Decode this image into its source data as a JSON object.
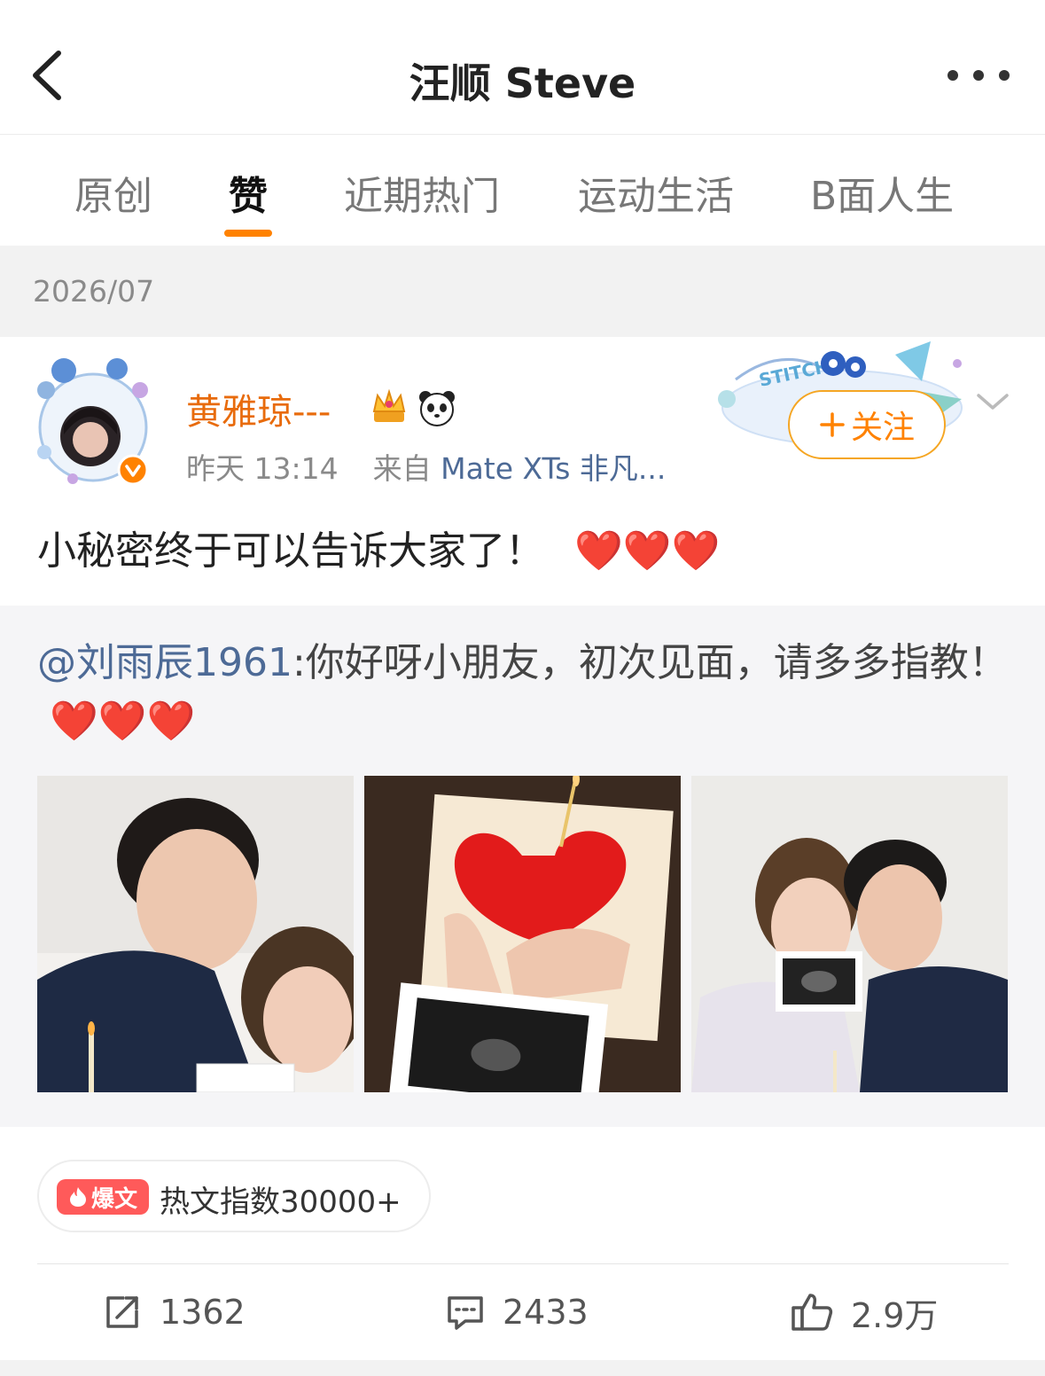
{
  "header": {
    "title": "汪顺 Steve",
    "back_icon": "chevron-left-icon",
    "more_icon": "more-dots-icon"
  },
  "tabs": [
    {
      "label": "原创",
      "active": false
    },
    {
      "label": "赞",
      "active": true
    },
    {
      "label": "近期热门",
      "active": false
    },
    {
      "label": "运动生活",
      "active": false
    },
    {
      "label": "B面人生",
      "active": false
    }
  ],
  "date_section": {
    "label": "2026/07"
  },
  "post": {
    "author": "黄雅琼---",
    "author_badges": [
      "crown-icon",
      "panda-icon"
    ],
    "time": "昨天 13:14",
    "source_prefix": "来自",
    "source": "Mate XTs 非凡...",
    "follow_label": "关注",
    "text": "小秘密终于可以告诉大家了！",
    "text_emoji": "❤️❤️❤️",
    "repost": {
      "mention": "@刘雨辰1961",
      "text": ":你好呀小朋友，初次见面，请多多指教！",
      "text_emoji": "❤️❤️❤️",
      "photos": [
        {
          "name": "photo-couple-selfie"
        },
        {
          "name": "photo-heart-cake-ultrasound"
        },
        {
          "name": "photo-couple-ultrasound"
        }
      ]
    },
    "hot": {
      "tag": "爆文",
      "text": "热文指数30000+"
    },
    "actions": {
      "repost_count": "1362",
      "comment_count": "2433",
      "like_count": "2.9万"
    }
  },
  "colors": {
    "accent": "#ff8200",
    "author_name": "#e86b0c",
    "link": "#4d6a96",
    "hot_tag": "#ff5a5a"
  }
}
